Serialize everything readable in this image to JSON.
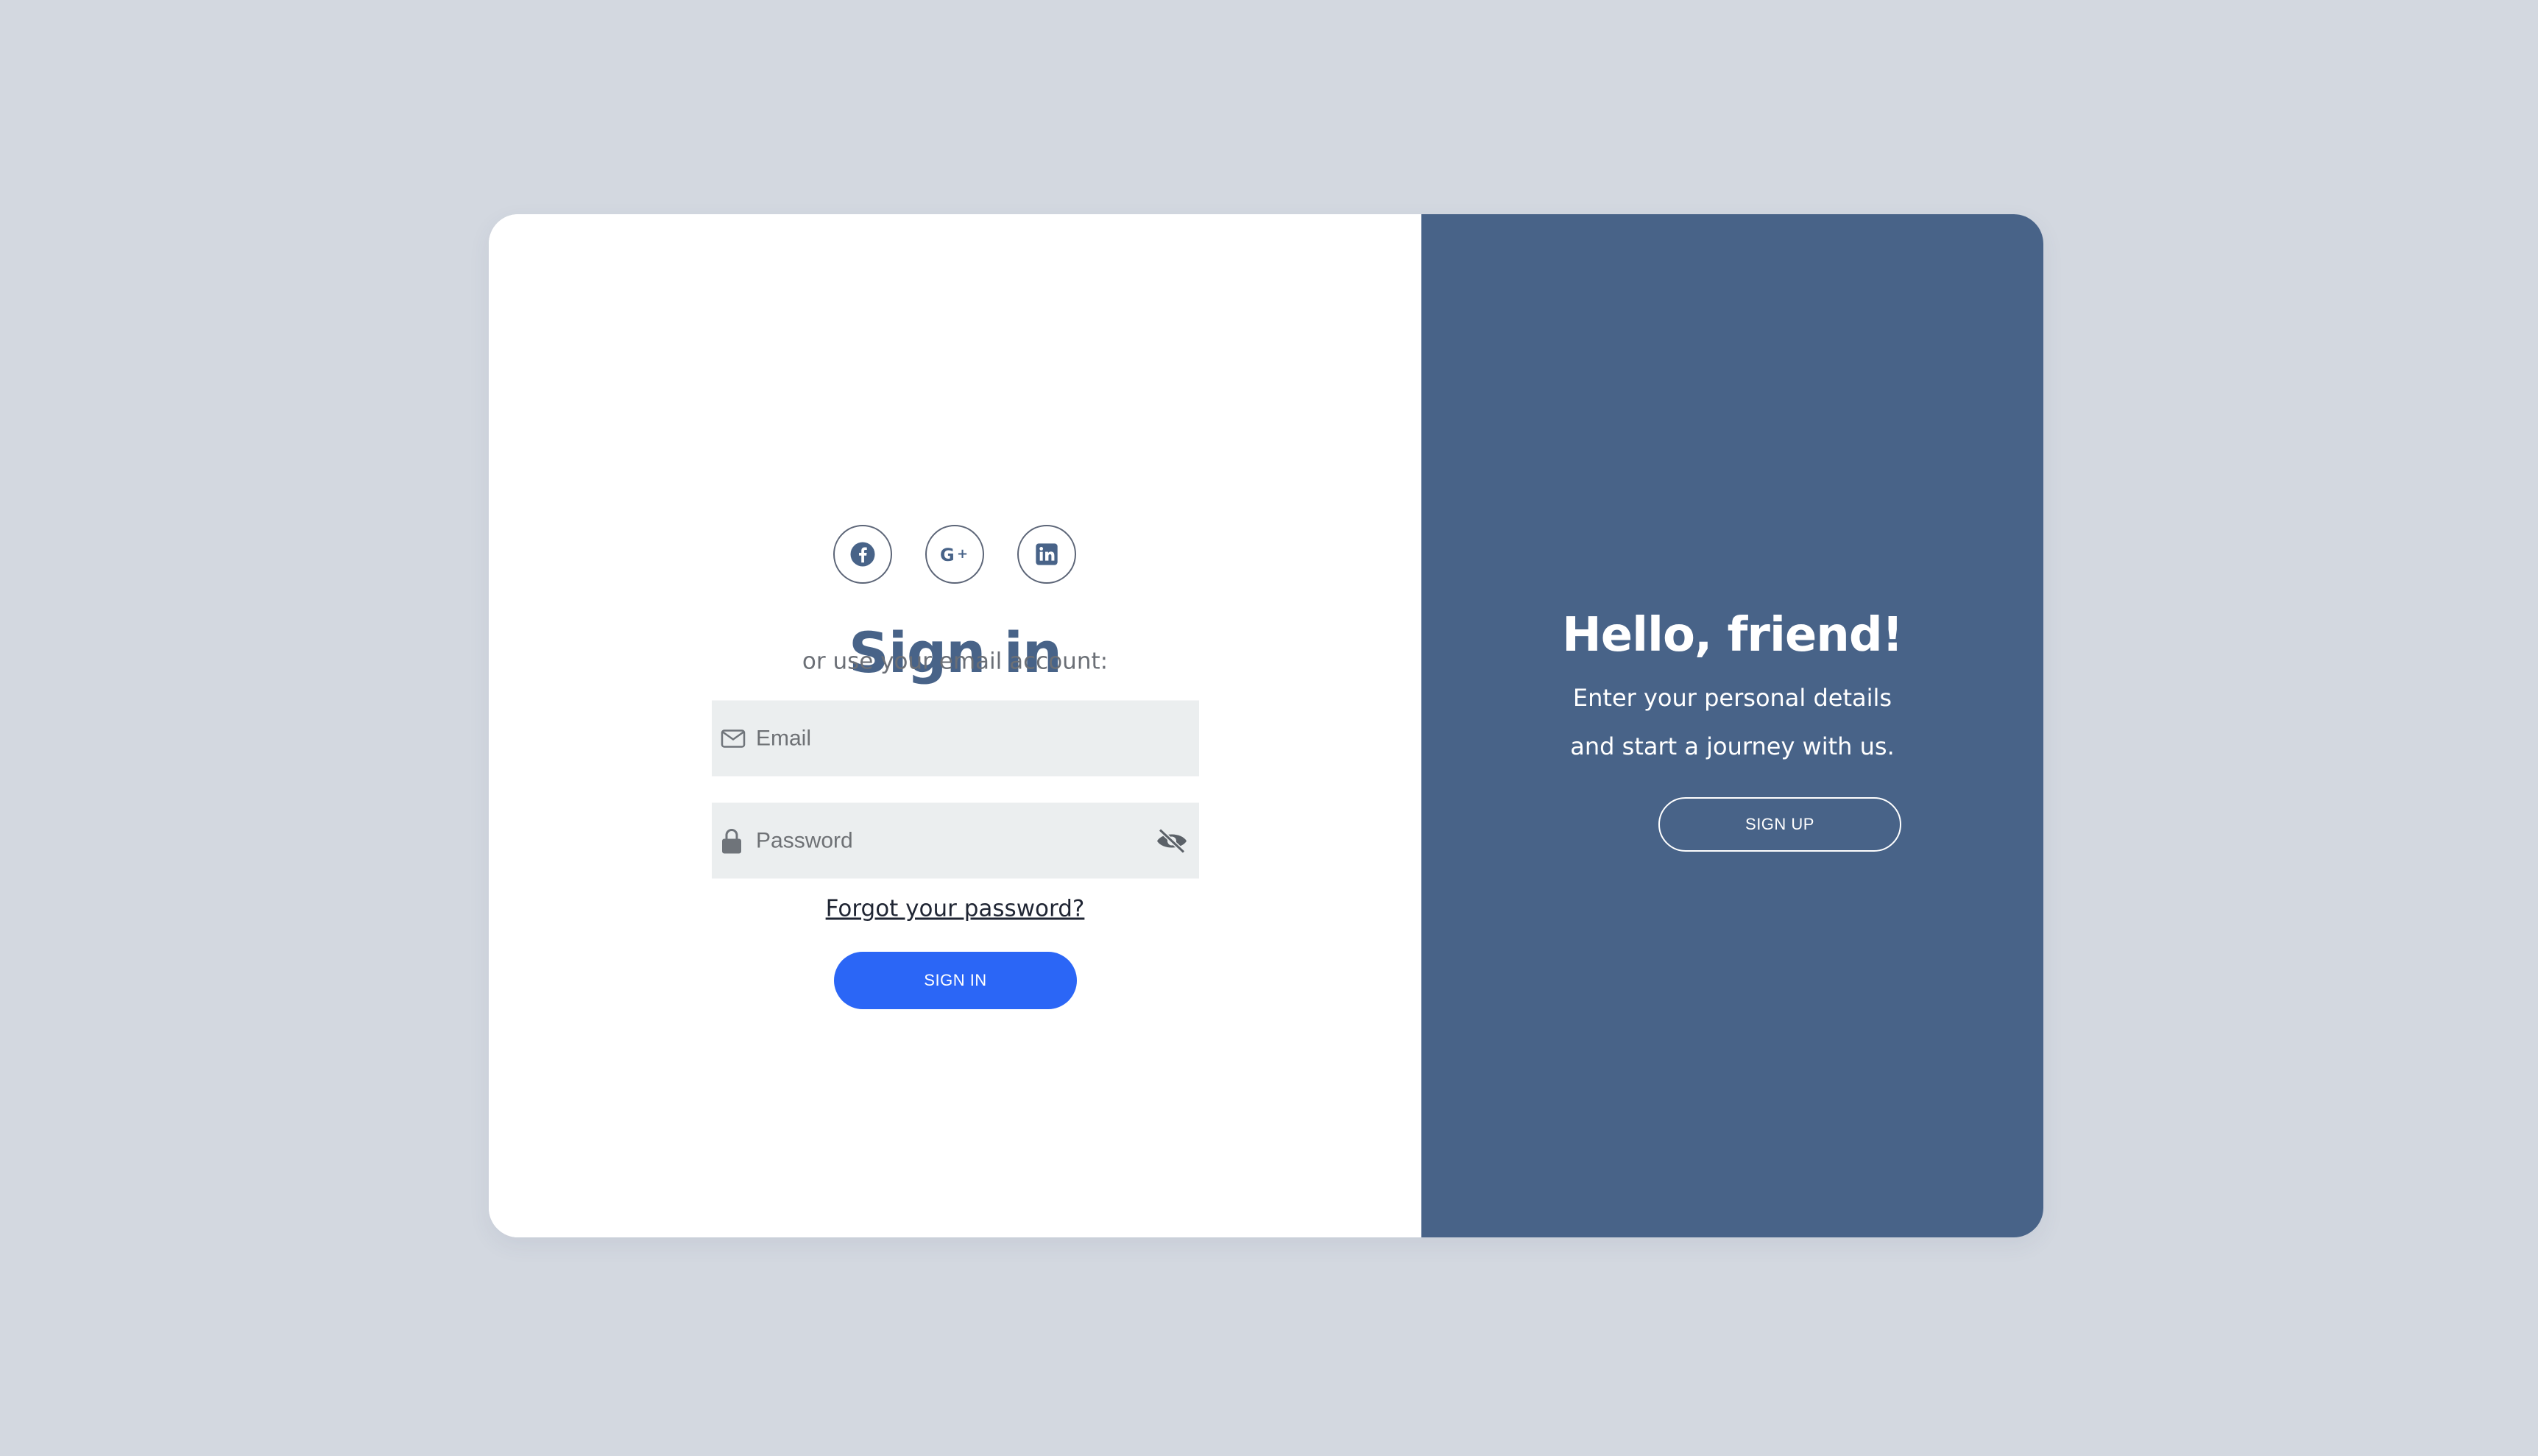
{
  "colors": {
    "page_background": "#d3d8e0",
    "card_background": "#ffffff",
    "panel_background": "#486388",
    "title_color": "#486388",
    "primary_button": "#2b66f6",
    "input_background": "#ebeeef",
    "muted_text": "#6b6f76"
  },
  "signin": {
    "title": "Sign in",
    "social": [
      {
        "name": "Facebook",
        "icon": "facebook-icon"
      },
      {
        "name": "Google Plus",
        "icon": "google-plus-icon"
      },
      {
        "name": "LinkedIn",
        "icon": "linkedin-icon"
      }
    ],
    "alt_text": "or use your email account:",
    "email": {
      "placeholder": "Email",
      "value": "",
      "icon": "mail-icon"
    },
    "password": {
      "placeholder": "Password",
      "value": "",
      "icon": "lock-icon",
      "toggle_icon": "eye-slash-icon"
    },
    "forgot_link": "Forgot your password?",
    "submit_label": "SIGN IN"
  },
  "panel": {
    "title": "Hello, friend!",
    "line1": "Enter your personal details",
    "line2": "and start a journey with us.",
    "button_label": "SIGN UP"
  }
}
